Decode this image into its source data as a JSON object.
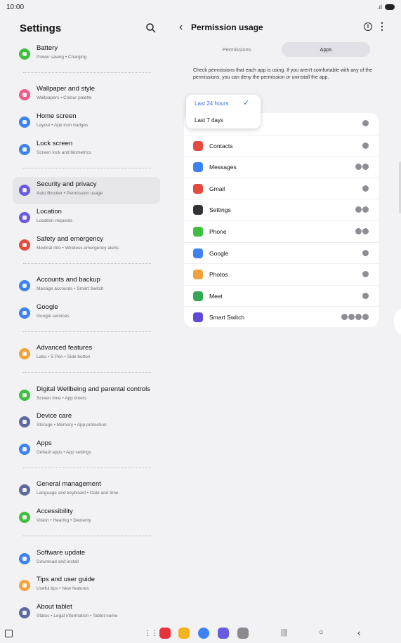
{
  "status_bar": {
    "time": "10:00",
    "signal": ".ıl"
  },
  "settings_pane": {
    "title": "Settings",
    "groups": [
      {
        "items": [
          {
            "title": "Battery",
            "subtitle": "Power saving • Charging",
            "color": "#3fbf3f"
          }
        ]
      },
      {
        "items": [
          {
            "title": "Wallpaper and style",
            "subtitle": "Wallpapers • Colour palette",
            "color": "#ef5a8a"
          },
          {
            "title": "Home screen",
            "subtitle": "Layout • App icon badges",
            "color": "#3d82f0"
          },
          {
            "title": "Lock screen",
            "subtitle": "Screen lock and biometrics",
            "color": "#3d82f0"
          }
        ]
      },
      {
        "items": [
          {
            "title": "Security and privacy",
            "subtitle": "Auto Blocker • Permission usage",
            "color": "#6a5ae0",
            "selected": true
          },
          {
            "title": "Location",
            "subtitle": "Location requests",
            "color": "#6a5ae0"
          },
          {
            "title": "Safety and emergency",
            "subtitle": "Medical info • Wireless emergency alerts",
            "color": "#e54a3f"
          }
        ]
      },
      {
        "items": [
          {
            "title": "Accounts and backup",
            "subtitle": "Manage accounts • Smart Switch",
            "color": "#3d82f0"
          },
          {
            "title": "Google",
            "subtitle": "Google services",
            "color": "#3d82f0"
          }
        ]
      },
      {
        "items": [
          {
            "title": "Advanced features",
            "subtitle": "Labs • S Pen • Side button",
            "color": "#f2a23a"
          }
        ]
      },
      {
        "items": [
          {
            "title": "Digital Wellbeing and parental controls",
            "subtitle": "Screen time • App timers",
            "color": "#3fbf3f"
          },
          {
            "title": "Device care",
            "subtitle": "Storage • Memory • App protection",
            "color": "#5d6a9e"
          },
          {
            "title": "Apps",
            "subtitle": "Default apps • App settings",
            "color": "#3d82f0"
          }
        ]
      },
      {
        "items": [
          {
            "title": "General management",
            "subtitle": "Language and keyboard • Date and time",
            "color": "#5d6a9e"
          },
          {
            "title": "Accessibility",
            "subtitle": "Vision • Hearing • Dexterity",
            "color": "#3fbf3f"
          }
        ]
      },
      {
        "items": [
          {
            "title": "Software update",
            "subtitle": "Download and install",
            "color": "#3d82f0"
          },
          {
            "title": "Tips and user guide",
            "subtitle": "Useful tips • New features",
            "color": "#f2a23a"
          },
          {
            "title": "About tablet",
            "subtitle": "Status • Legal information • Tablet name",
            "color": "#5d6a9e"
          }
        ]
      }
    ]
  },
  "permission_pane": {
    "back_glyph": "‹",
    "title": "Permission usage",
    "info_glyph": "i",
    "more_glyph": "⋮",
    "tabs": [
      {
        "label": "Permissions",
        "active": false
      },
      {
        "label": "Apps",
        "active": true
      }
    ],
    "description": "Check permissions that each app is using. If you aren't comfortable with any of the permissions, you can deny the permission or uninstall the app.",
    "period_dropdown": {
      "options": [
        "Last 24 hours",
        "Last 7 days"
      ],
      "selected": "Last 24 hours",
      "check_glyph": "✓"
    },
    "apps": [
      {
        "name": "",
        "color": "#ffffff",
        "perm_count": 1
      },
      {
        "name": "Contacts",
        "color": "#e54a3f",
        "perm_count": 1
      },
      {
        "name": "Messages",
        "color": "#3d82f0",
        "perm_count": 2
      },
      {
        "name": "Gmail",
        "color": "#e54a3f",
        "perm_count": 1
      },
      {
        "name": "Settings",
        "color": "#333338",
        "perm_count": 2
      },
      {
        "name": "Phone",
        "color": "#3fbf3f",
        "perm_count": 2
      },
      {
        "name": "Google",
        "color": "#3d82f0",
        "perm_count": 1
      },
      {
        "name": "Photos",
        "color": "#f2a23a",
        "perm_count": 1
      },
      {
        "name": "Meet",
        "color": "#34a853",
        "perm_count": 1
      },
      {
        "name": "Smart Switch",
        "color": "#5f4ad8",
        "perm_count": 4
      }
    ]
  },
  "nav_bar": {
    "apps_glyph": "⋮⋮⋮",
    "dock": [
      {
        "name": "app-red",
        "color": "#e5333b"
      },
      {
        "name": "my-files",
        "color": "#f4b320"
      },
      {
        "name": "messages",
        "color": "#3d82f0"
      },
      {
        "name": "internet",
        "color": "#6a5ae0"
      },
      {
        "name": "camera",
        "color": "#8a8a90"
      }
    ],
    "recents_glyph": "|||",
    "home_glyph": "○",
    "back_glyph": "‹"
  }
}
